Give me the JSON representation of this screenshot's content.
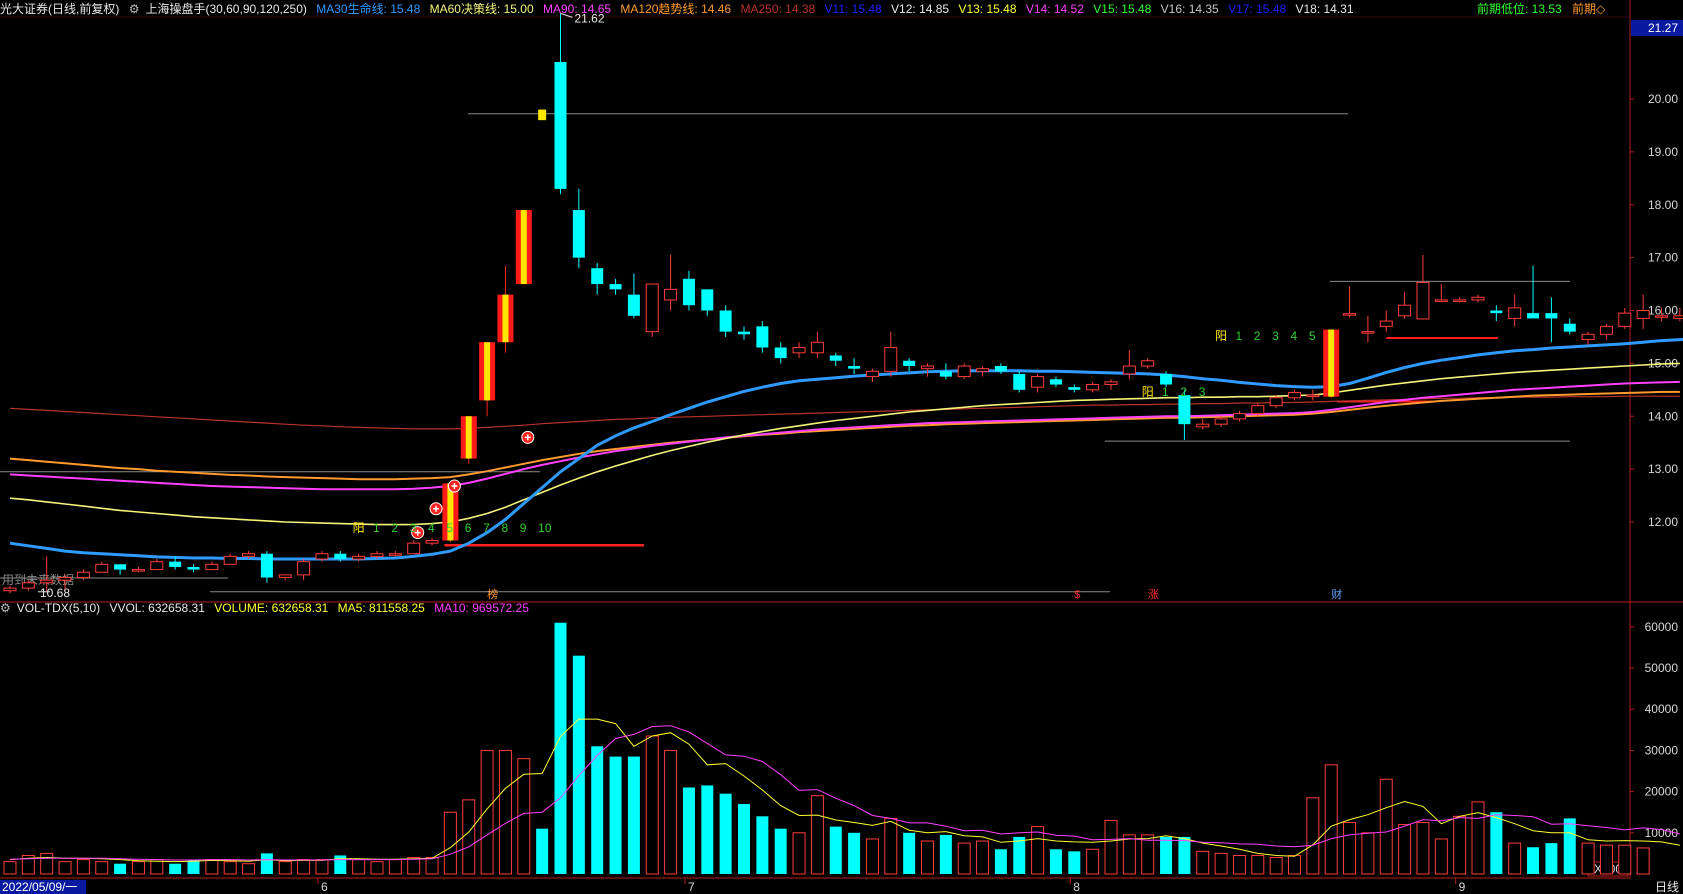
{
  "header": {
    "stock": "光大证券",
    "period": "(日线,前复权)",
    "formula": "上海操盘手(30,60,90,120,250)",
    "ma30": "MA30生命线: 15.48",
    "ma60": "MA60决策线: 15.00",
    "ma90": "MA90: 14.65",
    "ma120": "MA120趋势线: 14.46",
    "ma250": "MA250: 14.38",
    "v11": "V11: 15.48",
    "v12": "V12: 14.85",
    "v13": "V13: 15.48",
    "v14": "V14: 14.52",
    "v15": "V15: 15.48",
    "v16": "V16: 14.35",
    "v17": "V17: 15.48",
    "v18": "V18: 14.31",
    "prev_low": "前期低位: 13.53",
    "prev": "前期◇"
  },
  "colors": {
    "up": "#ff3c3c",
    "down": "#00ffff",
    "ma30": "#2f9bff",
    "ma60": "#f4f47a",
    "ma90": "#ff40ff",
    "ma120": "#ff9a2e",
    "ma250": "#b8322a",
    "vol_ma5": "#ffff30",
    "vol_ma10": "#ff40ff",
    "axis": "#b41e1e"
  },
  "price_axis": {
    "current": "21.27",
    "ticks": [
      "20.00",
      "19.00",
      "18.00",
      "17.00",
      "16.00",
      "15.00",
      "14.00",
      "13.00",
      "12.00"
    ]
  },
  "annotations": {
    "high_label": "21.62",
    "low_label": "10.68",
    "future_note": "用到未来数据",
    "yang": "阳",
    "seq1": [
      "1",
      "2",
      "3",
      "4",
      "5",
      "6",
      "7",
      "8",
      "9",
      "10"
    ],
    "seq2": [
      "1",
      "2",
      "3",
      "4",
      "5"
    ],
    "seq3": [
      "1",
      "2",
      "3"
    ],
    "marker_bang": "榜",
    "marker_s": "$",
    "marker_zhang": "涨",
    "marker_cai": "财"
  },
  "volume_header": {
    "name": "VOL-TDX(5,10)",
    "vvol": "VVOL: 632658.31",
    "volume": "VOLUME: 632658.31",
    "ma5": "MA5: 811558.25",
    "ma10": "MA10: 969572.25"
  },
  "volume_axis": {
    "ticks": [
      "60000",
      "50000",
      "40000",
      "30000",
      "20000",
      "10000"
    ],
    "unit": "X100"
  },
  "date_axis": {
    "first": "2022/05/09/一",
    "months": [
      "6",
      "7",
      "8",
      "9"
    ],
    "period_button": "日线"
  },
  "chart_data": {
    "type": "candlestick",
    "candles": [
      [
        10.7,
        10.8,
        10.65,
        10.75
      ],
      [
        10.75,
        10.9,
        10.7,
        10.85
      ],
      [
        10.85,
        11.35,
        10.7,
        10.9
      ],
      [
        10.9,
        11.0,
        10.7,
        10.95
      ],
      [
        10.95,
        11.1,
        10.9,
        11.05
      ],
      [
        11.05,
        11.25,
        11.05,
        11.2
      ],
      [
        11.2,
        11.2,
        11.0,
        11.1
      ],
      [
        11.1,
        11.15,
        11.05,
        11.1
      ],
      [
        11.1,
        11.3,
        11.1,
        11.25
      ],
      [
        11.25,
        11.35,
        11.1,
        11.15
      ],
      [
        11.15,
        11.2,
        11.05,
        11.1
      ],
      [
        11.1,
        11.25,
        11.1,
        11.2
      ],
      [
        11.2,
        11.4,
        11.2,
        11.35
      ],
      [
        11.35,
        11.45,
        11.3,
        11.4
      ],
      [
        11.4,
        11.45,
        10.85,
        10.95
      ],
      [
        10.95,
        11.0,
        10.9,
        11.0
      ],
      [
        11.0,
        11.3,
        10.9,
        11.25
      ],
      [
        11.3,
        11.45,
        11.25,
        11.4
      ],
      [
        11.4,
        11.45,
        11.25,
        11.3
      ],
      [
        11.3,
        11.4,
        11.25,
        11.35
      ],
      [
        11.35,
        11.45,
        11.3,
        11.4
      ],
      [
        11.4,
        11.45,
        11.35,
        11.4
      ],
      [
        11.4,
        11.65,
        11.4,
        11.6
      ],
      [
        11.6,
        11.7,
        11.55,
        11.65
      ],
      [
        11.65,
        12.73,
        11.62,
        12.73
      ],
      [
        13.2,
        14.0,
        13.1,
        14.0
      ],
      [
        14.3,
        15.4,
        14.0,
        15.4
      ],
      [
        15.4,
        16.85,
        15.2,
        16.3
      ],
      [
        16.5,
        17.9,
        16.5,
        17.9
      ],
      [
        19.8,
        19.9,
        19.6,
        19.6
      ],
      [
        20.7,
        21.62,
        18.2,
        18.3
      ],
      [
        17.9,
        18.3,
        16.8,
        17.0
      ],
      [
        16.8,
        16.9,
        16.3,
        16.5
      ],
      [
        16.5,
        16.6,
        16.3,
        16.4
      ],
      [
        16.3,
        16.7,
        15.85,
        15.9
      ],
      [
        15.6,
        16.5,
        15.5,
        16.5
      ],
      [
        16.2,
        17.05,
        16.0,
        16.4
      ],
      [
        16.6,
        16.75,
        16.0,
        16.1
      ],
      [
        16.4,
        16.4,
        15.9,
        16.0
      ],
      [
        16.0,
        16.1,
        15.5,
        15.6
      ],
      [
        15.6,
        15.7,
        15.45,
        15.55
      ],
      [
        15.7,
        15.8,
        15.2,
        15.3
      ],
      [
        15.3,
        15.4,
        15.0,
        15.1
      ],
      [
        15.2,
        15.4,
        15.1,
        15.3
      ],
      [
        15.2,
        15.6,
        15.1,
        15.4
      ],
      [
        15.15,
        15.2,
        14.95,
        15.05
      ],
      [
        14.95,
        15.1,
        14.8,
        14.9
      ],
      [
        14.75,
        14.9,
        14.65,
        14.85
      ],
      [
        14.85,
        15.6,
        14.75,
        15.3
      ],
      [
        15.05,
        15.1,
        14.85,
        14.95
      ],
      [
        14.9,
        15.0,
        14.75,
        14.95
      ],
      [
        14.85,
        15.0,
        14.7,
        14.75
      ],
      [
        14.75,
        15.0,
        14.7,
        14.95
      ],
      [
        14.85,
        14.95,
        14.75,
        14.9
      ],
      [
        14.95,
        15.0,
        14.8,
        14.85
      ],
      [
        14.8,
        14.85,
        14.45,
        14.5
      ],
      [
        14.55,
        14.8,
        14.45,
        14.75
      ],
      [
        14.7,
        14.75,
        14.55,
        14.6
      ],
      [
        14.55,
        14.6,
        14.45,
        14.5
      ],
      [
        14.5,
        14.65,
        14.45,
        14.6
      ],
      [
        14.6,
        14.7,
        14.5,
        14.65
      ],
      [
        14.8,
        15.25,
        14.7,
        14.95
      ],
      [
        14.95,
        15.1,
        14.9,
        15.05
      ],
      [
        14.8,
        14.85,
        14.55,
        14.6
      ],
      [
        14.4,
        14.5,
        13.55,
        13.85
      ],
      [
        13.8,
        13.95,
        13.75,
        13.85
      ],
      [
        13.85,
        14.0,
        13.8,
        13.95
      ],
      [
        13.95,
        14.1,
        13.9,
        14.05
      ],
      [
        14.05,
        14.25,
        14.0,
        14.2
      ],
      [
        14.2,
        14.4,
        14.15,
        14.35
      ],
      [
        14.35,
        14.5,
        14.3,
        14.45
      ],
      [
        14.4,
        14.5,
        14.3,
        14.4
      ],
      [
        14.37,
        15.64,
        14.35,
        15.64
      ],
      [
        15.94,
        16.45,
        15.87,
        15.94
      ],
      [
        15.6,
        15.9,
        15.4,
        15.6
      ],
      [
        15.7,
        16.0,
        15.6,
        15.8
      ],
      [
        15.9,
        16.35,
        15.85,
        16.1
      ],
      [
        15.84,
        17.05,
        15.84,
        16.53
      ],
      [
        16.2,
        16.5,
        16.15,
        16.2
      ],
      [
        16.2,
        16.25,
        16.15,
        16.2
      ],
      [
        16.2,
        16.3,
        16.15,
        16.25
      ],
      [
        16.0,
        16.1,
        15.8,
        15.95
      ],
      [
        15.85,
        16.3,
        15.7,
        16.05
      ],
      [
        15.95,
        16.85,
        15.9,
        15.85
      ],
      [
        15.95,
        16.25,
        15.4,
        15.85
      ],
      [
        15.75,
        15.85,
        15.55,
        15.6
      ],
      [
        15.45,
        15.6,
        15.35,
        15.55
      ],
      [
        15.55,
        15.75,
        15.45,
        15.7
      ],
      [
        15.7,
        16.05,
        15.65,
        15.95
      ],
      [
        15.85,
        16.3,
        15.65,
        16.0
      ],
      [
        15.9,
        16.05,
        15.8,
        15.9
      ],
      [
        15.85,
        16.05,
        15.8,
        15.9
      ],
      [
        15.85,
        16.35,
        15.75,
        16.1
      ]
    ],
    "volume_x100": [
      3000,
      4500,
      5000,
      3000,
      3500,
      3000,
      2500,
      3000,
      3500,
      2500,
      3500,
      3500,
      3000,
      2500,
      5000,
      3000,
      3500,
      3500,
      4500,
      3500,
      3000,
      3500,
      4000,
      4000,
      15000,
      18000,
      30000,
      30000,
      28000,
      11000,
      61000,
      53000,
      31000,
      28500,
      28500,
      33500,
      30000,
      21000,
      21500,
      19500,
      17000,
      14000,
      11000,
      10000,
      19000,
      11500,
      10000,
      8500,
      13500,
      10000,
      8000,
      9500,
      7500,
      8000,
      6000,
      9000,
      11500,
      6000,
      5500,
      6000,
      13000,
      9500,
      9500,
      9000,
      9000,
      5500,
      5000,
      4500,
      4500,
      4000,
      4500,
      18500,
      26500,
      12500,
      10000,
      23000,
      12000,
      12500,
      8500,
      14000,
      17500,
      15000,
      7500,
      6500,
      7500,
      13500,
      7500,
      7000,
      7000,
      6326
    ],
    "ma30": [
      11.6,
      11.55,
      11.5,
      11.45,
      11.42,
      11.4,
      11.38,
      11.36,
      11.34,
      11.33,
      11.32,
      11.32,
      11.31,
      11.31,
      11.3,
      11.3,
      11.3,
      11.3,
      11.3,
      11.3,
      11.31,
      11.32,
      11.35,
      11.39,
      11.45,
      11.6,
      11.8,
      12.05,
      12.35,
      12.65,
      12.95,
      13.2,
      13.45,
      13.63,
      13.78,
      13.9,
      14.03,
      14.15,
      14.27,
      14.37,
      14.47,
      14.55,
      14.62,
      14.67,
      14.7,
      14.73,
      14.76,
      14.78,
      14.8,
      14.82,
      14.84,
      14.85,
      14.86,
      14.86,
      14.86,
      14.86,
      14.85,
      14.85,
      14.84,
      14.83,
      14.82,
      14.81,
      14.8,
      14.78,
      14.75,
      14.71,
      14.68,
      14.64,
      14.61,
      14.58,
      14.56,
      14.55,
      14.56,
      14.62,
      14.72,
      14.83,
      14.92,
      15.0,
      15.06,
      15.11,
      15.16,
      15.2,
      15.24,
      15.26,
      15.29,
      15.31,
      15.33,
      15.35,
      15.37,
      15.4,
      15.43,
      15.45,
      15.48
    ],
    "ma60": [
      12.45,
      12.42,
      12.38,
      12.34,
      12.3,
      12.26,
      12.22,
      12.19,
      12.16,
      12.13,
      12.1,
      12.08,
      12.06,
      12.04,
      12.02,
      12.0,
      11.99,
      11.98,
      11.97,
      11.96,
      11.95,
      11.95,
      11.95,
      11.97,
      12.0,
      12.07,
      12.16,
      12.28,
      12.42,
      12.56,
      12.7,
      12.83,
      12.95,
      13.06,
      13.16,
      13.26,
      13.35,
      13.43,
      13.51,
      13.58,
      13.65,
      13.71,
      13.77,
      13.82,
      13.87,
      13.92,
      13.96,
      14.0,
      14.04,
      14.08,
      14.11,
      14.14,
      14.17,
      14.2,
      14.22,
      14.24,
      14.26,
      14.28,
      14.3,
      14.31,
      14.32,
      14.33,
      14.34,
      14.35,
      14.35,
      14.36,
      14.36,
      14.37,
      14.37,
      14.38,
      14.39,
      14.4,
      14.44,
      14.49,
      14.54,
      14.59,
      14.63,
      14.67,
      14.71,
      14.74,
      14.77,
      14.8,
      14.83,
      14.85,
      14.87,
      14.89,
      14.91,
      14.93,
      14.95,
      14.97,
      14.99,
      15.0
    ],
    "ma90": [
      12.9,
      12.88,
      12.86,
      12.84,
      12.82,
      12.8,
      12.78,
      12.76,
      12.74,
      12.72,
      12.7,
      12.68,
      12.67,
      12.66,
      12.65,
      12.64,
      12.63,
      12.62,
      12.62,
      12.62,
      12.62,
      12.62,
      12.63,
      12.65,
      12.68,
      12.74,
      12.82,
      12.91,
      13.0,
      13.08,
      13.15,
      13.22,
      13.28,
      13.34,
      13.39,
      13.44,
      13.48,
      13.52,
      13.56,
      13.6,
      13.63,
      13.66,
      13.69,
      13.72,
      13.75,
      13.77,
      13.79,
      13.81,
      13.83,
      13.85,
      13.87,
      13.88,
      13.89,
      13.9,
      13.91,
      13.92,
      13.93,
      13.94,
      13.95,
      13.96,
      13.97,
      13.98,
      13.99,
      14.0,
      14.0,
      14.01,
      14.02,
      14.03,
      14.04,
      14.05,
      14.06,
      14.08,
      14.12,
      14.17,
      14.22,
      14.27,
      14.31,
      14.35,
      14.38,
      14.41,
      14.44,
      14.47,
      14.5,
      14.52,
      14.54,
      14.56,
      14.58,
      14.6,
      14.62,
      14.63,
      14.64,
      14.65
    ],
    "ma120": [
      13.2,
      13.17,
      13.14,
      13.11,
      13.08,
      13.05,
      13.02,
      13.0,
      12.97,
      12.95,
      12.93,
      12.91,
      12.89,
      12.88,
      12.86,
      12.85,
      12.84,
      12.83,
      12.82,
      12.81,
      12.81,
      12.81,
      12.82,
      12.83,
      12.85,
      12.9,
      12.96,
      13.03,
      13.1,
      13.17,
      13.23,
      13.29,
      13.34,
      13.38,
      13.42,
      13.46,
      13.5,
      13.53,
      13.56,
      13.59,
      13.62,
      13.65,
      13.67,
      13.7,
      13.72,
      13.74,
      13.76,
      13.78,
      13.8,
      13.82,
      13.83,
      13.85,
      13.86,
      13.87,
      13.88,
      13.89,
      13.9,
      13.91,
      13.92,
      13.93,
      13.94,
      13.95,
      13.96,
      13.97,
      13.97,
      13.98,
      13.99,
      14.0,
      14.01,
      14.02,
      14.03,
      14.05,
      14.08,
      14.12,
      14.16,
      14.2,
      14.23,
      14.26,
      14.29,
      14.31,
      14.33,
      14.35,
      14.37,
      14.39,
      14.4,
      14.41,
      14.42,
      14.43,
      14.44,
      14.45,
      14.46,
      14.46
    ],
    "ma250": [
      14.15,
      14.13,
      14.11,
      14.09,
      14.07,
      14.05,
      14.03,
      14.01,
      13.99,
      13.97,
      13.95,
      13.93,
      13.91,
      13.89,
      13.87,
      13.85,
      13.83,
      13.82,
      13.8,
      13.79,
      13.78,
      13.77,
      13.76,
      13.76,
      13.76,
      13.77,
      13.79,
      13.81,
      13.83,
      13.86,
      13.88,
      13.9,
      13.92,
      13.94,
      13.95,
      13.97,
      13.98,
      13.99,
      14.0,
      14.01,
      14.02,
      14.03,
      14.04,
      14.05,
      14.06,
      14.07,
      14.08,
      14.09,
      14.1,
      14.11,
      14.12,
      14.13,
      14.14,
      14.15,
      14.16,
      14.17,
      14.18,
      14.19,
      14.2,
      14.21,
      14.21,
      14.22,
      14.22,
      14.23,
      14.23,
      14.24,
      14.24,
      14.25,
      14.25,
      14.26,
      14.26,
      14.27,
      14.28,
      14.29,
      14.3,
      14.31,
      14.32,
      14.33,
      14.34,
      14.34,
      14.35,
      14.35,
      14.36,
      14.36,
      14.36,
      14.37,
      14.37,
      14.37,
      14.38,
      14.38,
      14.38,
      14.38
    ],
    "vol_ma5": [
      3500,
      3800,
      4000,
      3800,
      3800,
      3700,
      3500,
      3200,
      3100,
      3000,
      3100,
      3300,
      3200,
      3100,
      3500,
      3200,
      3300,
      3300,
      3700,
      3700,
      3600,
      3600,
      3700,
      3800,
      6400,
      10200,
      15800,
      20800,
      24200,
      24400,
      33400,
      37600,
      37600,
      36500,
      31000,
      33500,
      34300,
      31500,
      26500,
      26800,
      23800,
      20400,
      16600,
      14200,
      14300,
      13100,
      12500,
      11800,
      12800,
      10600,
      10000,
      10300,
      9300,
      9000,
      7700,
      8000,
      8600,
      8000,
      7800,
      7700,
      8000,
      8500,
      8600,
      9300,
      8600,
      7500,
      6800,
      6000,
      5000,
      4500,
      4300,
      7100,
      11600,
      13200,
      14400,
      16100,
      17600,
      16400,
      12200,
      14000,
      14900,
      13700,
      12200,
      10500,
      10000,
      10000,
      8300,
      8000,
      8100,
      8000,
      7800,
      7000
    ],
    "vol_ma10": [
      3600,
      3700,
      3800,
      3800,
      3800,
      3800,
      3700,
      3600,
      3500,
      3400,
      3400,
      3500,
      3500,
      3400,
      3500,
      3400,
      3400,
      3400,
      3500,
      3500,
      3500,
      3500,
      3600,
      3700,
      4800,
      6600,
      9500,
      12300,
      14700,
      15000,
      18500,
      23900,
      28800,
      32900,
      33900,
      35800,
      36000,
      34500,
      31700,
      28900,
      28600,
      27300,
      24100,
      20300,
      20500,
      18400,
      16600,
      14200,
      13500,
      12400,
      12400,
      11600,
      10500,
      10600,
      9700,
      10000,
      10200,
      9400,
      9200,
      8300,
      8400,
      8600,
      8200,
      8200,
      8100,
      7700,
      7600,
      7300,
      7200,
      6800,
      6600,
      7000,
      8600,
      9500,
      9900,
      10200,
      11600,
      13200,
      12900,
      13700,
      13500,
      14400,
      14200,
      13900,
      12100,
      12200,
      11700,
      11300,
      10700,
      11200,
      10800,
      9700
    ]
  }
}
